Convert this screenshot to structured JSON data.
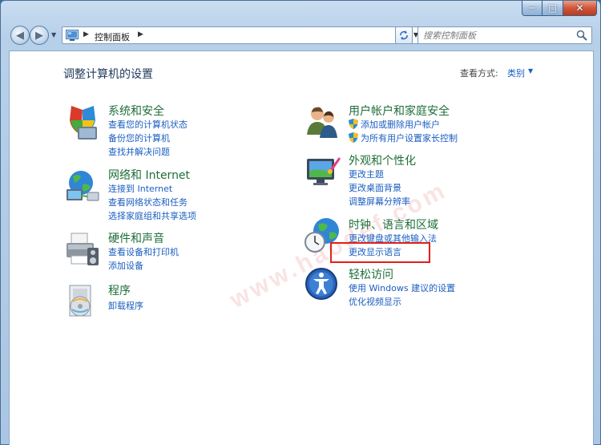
{
  "window": {
    "min": "─",
    "max": "□",
    "close": "✕"
  },
  "nav": {
    "address": "控制面板",
    "search_placeholder": "搜索控制面板"
  },
  "page": {
    "title": "调整计算机的设置",
    "view_by_label": "查看方式:",
    "view_by_value": "类别"
  },
  "watermark": "www.haodef.com",
  "categories": {
    "system": {
      "title": "系统和安全",
      "links": [
        "查看您的计算机状态",
        "备份您的计算机",
        "查找并解决问题"
      ]
    },
    "network": {
      "title": "网络和 Internet",
      "links": [
        "连接到 Internet",
        "查看网络状态和任务",
        "选择家庭组和共享选项"
      ]
    },
    "hardware": {
      "title": "硬件和声音",
      "links": [
        "查看设备和打印机",
        "添加设备"
      ]
    },
    "programs": {
      "title": "程序",
      "links": [
        "卸载程序"
      ]
    },
    "accounts": {
      "title": "用户帐户和家庭安全",
      "links": [
        "添加或删除用户帐户",
        "为所有用户设置家长控制"
      ]
    },
    "appearance": {
      "title": "外观和个性化",
      "links": [
        "更改主题",
        "更改桌面背景",
        "调整屏幕分辨率"
      ]
    },
    "clock": {
      "title": "时钟、语言和区域",
      "links": [
        "更改键盘或其他输入法",
        "更改显示语言"
      ]
    },
    "ease": {
      "title": "轻松访问",
      "links": [
        "使用 Windows 建议的设置",
        "优化视频显示"
      ]
    }
  },
  "colors": {
    "category_title": "#1d6e39",
    "link": "#1a5ec0",
    "highlight": "#e0201a"
  }
}
